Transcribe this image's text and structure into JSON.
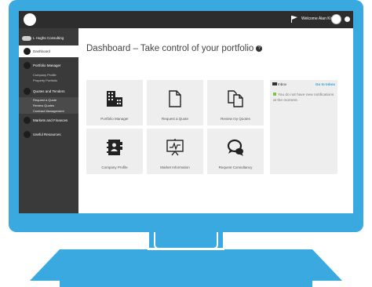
{
  "topbar": {
    "welcome": "Welcome Alan King"
  },
  "sidebar": {
    "company": "L Hughs Consulting",
    "items": [
      {
        "label": "Dashboard",
        "sub": []
      },
      {
        "label": "Portfolio Manager",
        "sub": [
          "Company Profile",
          "Property Portfolio"
        ]
      },
      {
        "label": "Quotes and Tenders",
        "sub": [
          "Request a Quote",
          "Review Quotes",
          "Contract Management"
        ]
      },
      {
        "label": "Markets and Finances",
        "sub": []
      },
      {
        "label": "Useful Resources",
        "sub": []
      }
    ]
  },
  "main": {
    "title": "Dashboard – Take control of your portfolio",
    "tiles": [
      {
        "label": "Portfolio Manager",
        "icon": "building-icon"
      },
      {
        "label": "Request a Quote",
        "icon": "document-icon"
      },
      {
        "label": "Review my Quotes",
        "icon": "copy-icon"
      },
      {
        "label": "Company Profile",
        "icon": "contact-book-icon"
      },
      {
        "label": "Market Information",
        "icon": "chart-board-icon"
      },
      {
        "label": "Request Consultancy",
        "icon": "chat-bubbles-icon"
      }
    ]
  },
  "inbox": {
    "title": "Inbox",
    "link": "Go to Inbox",
    "message": "You do not have new notifications at the moment."
  },
  "colors": {
    "monitor": "#39a9e0",
    "topbar": "#2d2d2d",
    "sidebar": "#3a3a3a",
    "tile": "#eeeeee",
    "link": "#2a9fd8",
    "flag": "#7cc243"
  }
}
